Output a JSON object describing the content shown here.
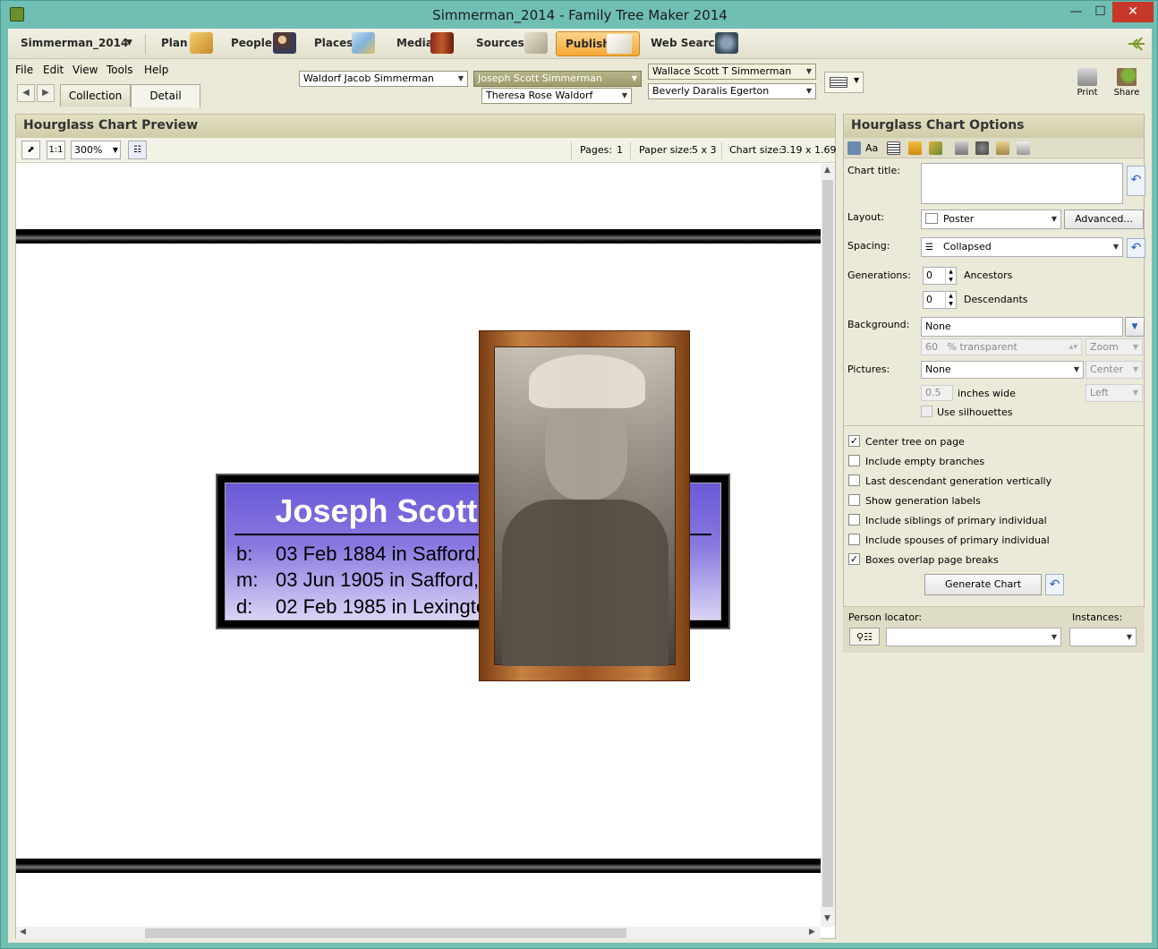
{
  "window": {
    "title": "Simmerman_2014 - Family Tree Maker 2014",
    "min": "—",
    "max": "☐",
    "close": "✕"
  },
  "nav": {
    "tree_name": "Simmerman_2014",
    "items": [
      "Plan",
      "People",
      "Places",
      "Media",
      "Sources",
      "Publish",
      "Web Search"
    ]
  },
  "menu": [
    "File",
    "Edit",
    "View",
    "Tools",
    "Help"
  ],
  "tabs": [
    "Collection",
    "Detail"
  ],
  "family": {
    "father": "Waldorf Jacob Simmerman",
    "mother": "Theresa Rose Waldorf",
    "focus": "Joseph Scott Simmerman",
    "spouse1": "Wallace Scott T Simmerman",
    "spouse2": "Beverly Daralis Egerton"
  },
  "right_tools": [
    "Print",
    "Share"
  ],
  "preview": {
    "title": "Hourglass Chart Preview",
    "zoom": "300%",
    "pages_label": "Pages:",
    "pages": "1",
    "paper_label": "Paper size:",
    "paper": "5 x 3",
    "chart_label": "Chart size:",
    "chart": "3.19 x 1.69"
  },
  "person": {
    "name": "Joseph Scott Simmerman",
    "facts": [
      {
        "k": "b:",
        "v": "03 Feb 1884 in Safford, England"
      },
      {
        "k": "m:",
        "v": "03 Jun 1905 in Safford, England"
      },
      {
        "k": "d:",
        "v": "02 Feb 1985 in Lexington, Kentucky"
      }
    ]
  },
  "options": {
    "title": "Hourglass Chart Options",
    "chart_title_label": "Chart title:",
    "chart_title_value": "",
    "layout_label": "Layout:",
    "layout": "Poster",
    "advanced": "Advanced...",
    "spacing_label": "Spacing:",
    "spacing": "Collapsed",
    "generations_label": "Generations:",
    "ancestors": "0",
    "ancestors_label": "Ancestors",
    "descendants": "0",
    "descendants_label": "Descendants",
    "background_label": "Background:",
    "background": "None",
    "transparent_value": "60",
    "transparent_label": "% transparent",
    "bg_mode": "Zoom",
    "pictures_label": "Pictures:",
    "pictures": "None",
    "pic_align": "Center",
    "inches_value": "0.5",
    "inches_label": "inches wide",
    "pic_side": "Left",
    "silhouettes": "Use silhouettes",
    "checks": [
      {
        "label": "Center tree on page",
        "checked": true
      },
      {
        "label": "Include empty branches",
        "checked": false
      },
      {
        "label": "Last descendant generation vertically",
        "checked": false
      },
      {
        "label": "Show generation labels",
        "checked": false
      },
      {
        "label": "Include siblings of primary individual",
        "checked": false
      },
      {
        "label": "Include spouses of primary individual",
        "checked": false
      },
      {
        "label": "Boxes overlap page breaks",
        "checked": true
      }
    ],
    "generate": "Generate Chart",
    "locator_label": "Person locator:",
    "instances_label": "Instances:"
  }
}
